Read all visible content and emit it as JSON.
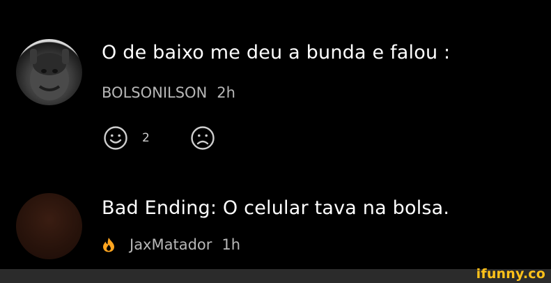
{
  "comments": [
    {
      "text": "O de baixo me deu a bunda e falou :",
      "username": "BOLSONILSON",
      "time": "2h",
      "reactions": {
        "smile_count": "2"
      }
    },
    {
      "text": "Bad Ending: O celular tava na bolsa.",
      "username": "JaxMatador",
      "time": "1h"
    }
  ],
  "footer": {
    "brand": "ifunny.co"
  },
  "colors": {
    "background": "#000000",
    "meta": "#b7b7b7",
    "brand": "#ffc21a",
    "footer": "#2b2b2b"
  },
  "icons": [
    "smile-icon",
    "sad-face-icon",
    "fire-icon",
    "avatar"
  ]
}
